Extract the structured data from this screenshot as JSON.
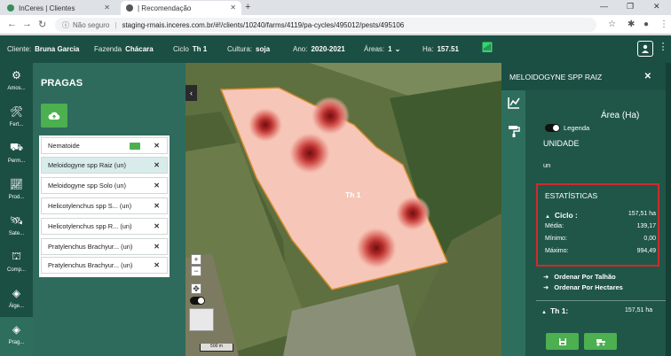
{
  "browser": {
    "tabs": [
      {
        "title": "InCeres | Clientes"
      },
      {
        "title": "| Recomendação"
      }
    ],
    "security_label": "Não seguro",
    "url": "staging-rmais.inceres.com.br/#!/clients/10240/farms/4119/pa-cycles/495012/pests/495106"
  },
  "header": {
    "cliente_label": "Cliente:",
    "cliente_value": "Bruna Garcia",
    "fazenda_label": "Fazenda",
    "fazenda_value": "Chácara",
    "ciclo_label": "Ciclo",
    "ciclo_value": "Th 1",
    "cultura_label": "Cultura:",
    "cultura_value": "soja",
    "ano_label": "Ano:",
    "ano_value": "2020-2021",
    "areas_label": "Áreas:",
    "areas_value": "1",
    "ha_label": "Ha:",
    "ha_value": "157.51"
  },
  "rail": [
    {
      "label": "Amos...",
      "icon": "sample-icon"
    },
    {
      "label": "Fert...",
      "icon": "fertilizer-icon"
    },
    {
      "label": "Perm...",
      "icon": "permission-icon"
    },
    {
      "label": "Prod...",
      "icon": "chart-icon"
    },
    {
      "label": "Sate...",
      "icon": "satellite-icon"
    },
    {
      "label": "Comp...",
      "icon": "compare-icon"
    },
    {
      "label": "Álge...",
      "icon": "layers-icon"
    },
    {
      "label": "Prag...",
      "icon": "layers-icon"
    }
  ],
  "pragas": {
    "title": "PRAGAS",
    "items": [
      {
        "label": "Nematoide"
      },
      {
        "label": "Meloidogyne spp Raiz (un)"
      },
      {
        "label": "Meloidogyne spp Solo (un)"
      },
      {
        "label": "Helicotylenchus spp S... (un)"
      },
      {
        "label": "Helicotylenchus spp R... (un)"
      },
      {
        "label": "Pratylenchus Brachyur... (un)"
      },
      {
        "label": "Pratylenchus Brachyur... (un)"
      }
    ]
  },
  "map": {
    "field_label": "Th 1",
    "scale_label": "500 m"
  },
  "details": {
    "title": "MELOIDOGYNE SPP RAIZ",
    "area_label": "Área (Ha)",
    "legend_label": "Legenda",
    "unidade_label": "UNIDADE",
    "unit_value": "un",
    "stats_title": "ESTATÍSTICAS",
    "ciclo_label": "Ciclo :",
    "ciclo_value": "157,51 ha",
    "media_label": "Média:",
    "media_value": "139,17",
    "minimo_label": "Mínimo:",
    "minimo_value": "0,00",
    "maximo_label": "Máximo:",
    "maximo_value": "994,49",
    "order_talhao": "Ordenar Por Talhão",
    "order_hectares": "Ordenar Por Hectares",
    "th1_label": "Th 1:",
    "th1_value": "157,51 ha"
  },
  "colors": {
    "header_bg": "#1b4f43",
    "panel_bg": "#2e6b5d",
    "accent_green": "#4caf50",
    "stats_border": "#d12a2a",
    "heat_low": "#f6c6b8",
    "heat_high": "#8e1a1a"
  }
}
